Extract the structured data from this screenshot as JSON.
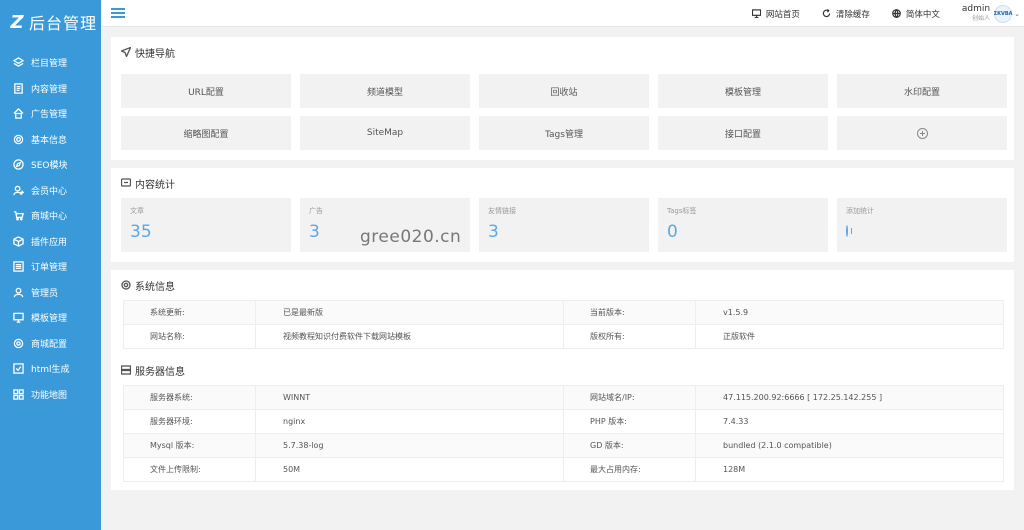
{
  "sidebar": {
    "logo_text": "后台管理",
    "items": [
      {
        "label": "栏目管理",
        "icon": "layers-icon"
      },
      {
        "label": "内容管理",
        "icon": "document-icon"
      },
      {
        "label": "广告管理",
        "icon": "house-icon"
      },
      {
        "label": "基本信息",
        "icon": "gear-icon"
      },
      {
        "label": "SEO模块",
        "icon": "compass-icon"
      },
      {
        "label": "会员中心",
        "icon": "user-icon"
      },
      {
        "label": "商城中心",
        "icon": "cart-icon"
      },
      {
        "label": "插件应用",
        "icon": "cube-icon"
      },
      {
        "label": "订单管理",
        "icon": "list-icon"
      },
      {
        "label": "管理员",
        "icon": "person-icon"
      },
      {
        "label": "模板管理",
        "icon": "monitor-icon"
      },
      {
        "label": "商城配置",
        "icon": "settings-icon"
      },
      {
        "label": "html生成",
        "icon": "check-square-icon"
      },
      {
        "label": "功能地图",
        "icon": "grid-icon"
      }
    ]
  },
  "topbar": {
    "home_label": "网站首页",
    "clear_cache_label": "清除缓存",
    "lang_label": "简体中文",
    "user_name": "admin",
    "user_role": "创始人",
    "avatar_text": "ΣKVBA"
  },
  "quick_nav": {
    "title": "快捷导航",
    "buttons": [
      "URL配置",
      "频道模型",
      "回收站",
      "模板管理",
      "水印配置",
      "缩略图配置",
      "SiteMap",
      "Tags管理",
      "接口配置"
    ]
  },
  "stats": {
    "title": "内容统计",
    "items": [
      {
        "label": "文章",
        "value": "35"
      },
      {
        "label": "广告",
        "value": "3"
      },
      {
        "label": "友情链接",
        "value": "3"
      },
      {
        "label": "Tags标签",
        "value": "0"
      }
    ],
    "add_label": "添加统计"
  },
  "watermark": "gree020.cn",
  "system_info": {
    "title": "系统信息",
    "rows": [
      {
        "k1": "系统更新:",
        "v1": "已是最新版",
        "k2": "当前版本:",
        "v2": "v1.5.9"
      },
      {
        "k1": "网站名称:",
        "v1": "视频教程知识付费软件下载网站模板",
        "k2": "版权所有:",
        "v2": "正版软件"
      }
    ]
  },
  "server_info": {
    "title": "服务器信息",
    "rows": [
      {
        "k1": "服务器系统:",
        "v1": "WINNT",
        "k2": "网站域名/IP:",
        "v2": "47.115.200.92:6666 [ 172.25.142.255 ]"
      },
      {
        "k1": "服务器环境:",
        "v1": "nginx",
        "k2": "PHP 版本:",
        "v2": "7.4.33"
      },
      {
        "k1": "Mysql 版本:",
        "v1": "5.7.38-log",
        "k2": "GD 版本:",
        "v2": "bundled (2.1.0 compatible)"
      },
      {
        "k1": "文件上传限制:",
        "v1": "50M",
        "k2": "最大占用内存:",
        "v2": "128M"
      }
    ]
  }
}
